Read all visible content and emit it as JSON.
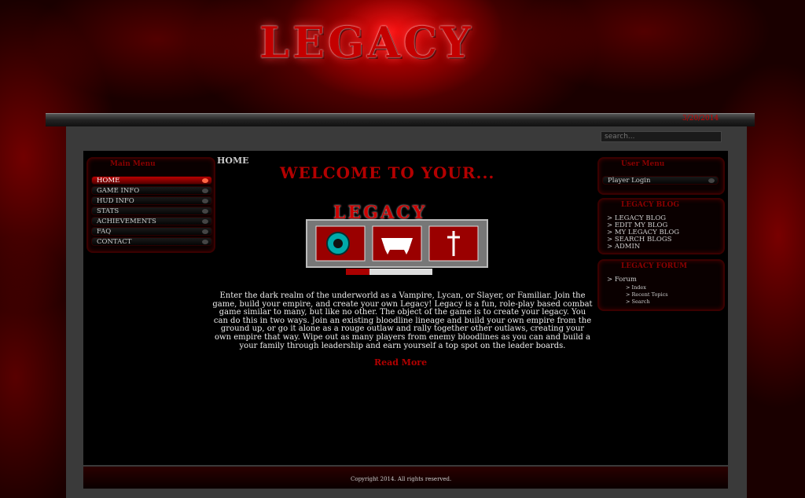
{
  "logo_text": "LEGACY",
  "date": "3/20/2014",
  "search": {
    "placeholder": "search..."
  },
  "main_menu": {
    "title": "Main Menu",
    "items": [
      "HOME",
      "GAME INFO",
      "HUD INFO",
      "STATS",
      "ACHIEVEMENTS",
      "FAQ",
      "CONTACT"
    ]
  },
  "user_menu": {
    "title": "User Menu",
    "login_label": "Player Login"
  },
  "blog": {
    "title": "LEGACY BLOG",
    "items": [
      "LEGACY BLOG",
      "EDIT MY BLOG",
      "MY LEGACY BLOG",
      "SEARCH BLOGS",
      "ADMIN"
    ]
  },
  "forum": {
    "title": "LEGACY FORUM",
    "item": "Forum",
    "subitems": [
      "Index",
      "Recent Topics",
      "Search"
    ]
  },
  "main": {
    "heading": "HOME",
    "welcome": "WELCOME TO YOUR...",
    "emblem_text": "LEGACY",
    "intro": "Enter the dark realm of the underworld as a Vampire, Lycan, or Slayer, or Familiar. Join the game, build your empire, and create your own Legacy! Legacy is a fun, role-play based combat game similar to many, but like no other. The object of the game is to create your legacy. You can do this in two ways. Join an existing bloodline lineage and build your own empire from the ground up, or go it alone as a rouge outlaw and rally together other outlaws, creating your own empire that way. Wipe out as many players from enemy bloodlines as you can and build a your family through leadership and earn yourself a top spot on the leader boards.",
    "read_more": "Read More"
  },
  "footer": {
    "copyright": "Copyright 2014. All rights reserved."
  },
  "colors": {
    "accent": "#b30000",
    "background": "#000000"
  }
}
